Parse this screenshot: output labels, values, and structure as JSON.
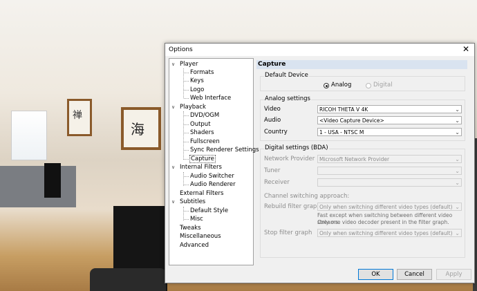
{
  "window": {
    "title": "Options",
    "close_glyph": "✕"
  },
  "tree": {
    "nodes": [
      {
        "label": "Player"
      },
      {
        "label": "Formats"
      },
      {
        "label": "Keys"
      },
      {
        "label": "Logo"
      },
      {
        "label": "Web Interface"
      },
      {
        "label": "Playback"
      },
      {
        "label": "DVD/OGM"
      },
      {
        "label": "Output"
      },
      {
        "label": "Shaders"
      },
      {
        "label": "Fullscreen"
      },
      {
        "label": "Sync Renderer Settings"
      },
      {
        "label": "Capture"
      },
      {
        "label": "Internal Filters"
      },
      {
        "label": "Audio Switcher"
      },
      {
        "label": "Audio Renderer"
      },
      {
        "label": "External Filters"
      },
      {
        "label": "Subtitles"
      },
      {
        "label": "Default Style"
      },
      {
        "label": "Misc"
      },
      {
        "label": "Tweaks"
      },
      {
        "label": "Miscellaneous"
      },
      {
        "label": "Advanced"
      }
    ],
    "selected": "Capture"
  },
  "page": {
    "header": "Capture",
    "default_device": {
      "group_label": "Default Device",
      "options": [
        "Analog",
        "Digital"
      ],
      "selected": "Analog"
    },
    "analog": {
      "group_label": "Analog settings",
      "video_label": "Video",
      "video_value": "RICOH THETA V 4K",
      "audio_label": "Audio",
      "audio_value": "<Video Capture Device>",
      "country_label": "Country",
      "country_value": "1 - USA - NTSC M"
    },
    "digital": {
      "group_label": "Digital settings (BDA)",
      "provider_label": "Network Provider",
      "provider_value": "Microsoft Network Provider",
      "tuner_label": "Tuner",
      "tuner_value": "",
      "receiver_label": "Receiver",
      "receiver_value": "",
      "channel_switching_label": "Channel switching approach:",
      "rebuild_label": "Rebuild filter graph",
      "rebuild_value": "Only when switching different video types (default)",
      "rebuild_note_1": "Fast except when switching between different video streams.",
      "rebuild_note_2": "Only one video decoder present in the filter graph.",
      "stop_label": "Stop filter graph",
      "stop_value": "Only when switching different video types (default)"
    }
  },
  "buttons": {
    "ok": "OK",
    "cancel": "Cancel",
    "apply": "Apply"
  },
  "icons": {
    "expanded": "chevron-down-icon",
    "dropdown": "dropdown-arrow-icon"
  },
  "colors": {
    "header_bg": "#d9e3f0",
    "default_button_border": "#0078d7"
  }
}
